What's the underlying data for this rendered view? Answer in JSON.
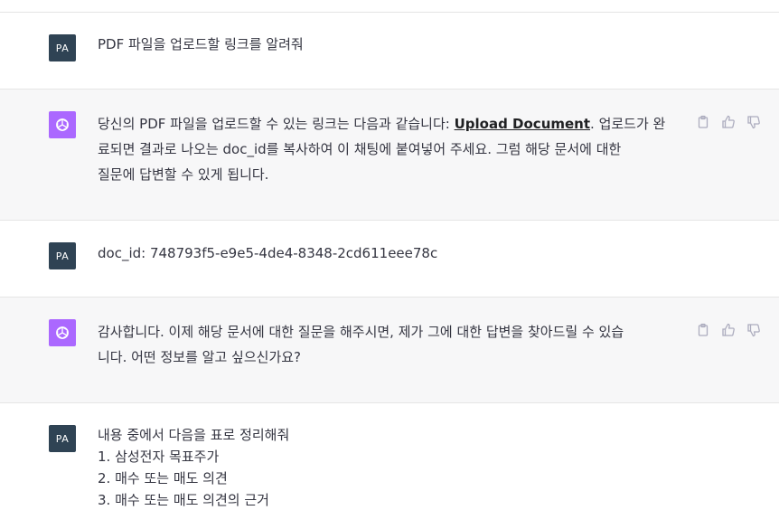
{
  "user_initials": "PA",
  "messages": [
    {
      "role": "user",
      "lines": [
        "PDF 파일을 업로드할 링크를 알려줘"
      ]
    },
    {
      "role": "assistant",
      "line1_pre": "당신의 PDF 파일을 업로드할 수 있는 링크는 다음과 같습니다: ",
      "link_text": "Upload Document",
      "line1_post": ". 업로드가 완",
      "line2": "료되면 결과로 나오는 doc_id를 복사하여 이 채팅에 붙여넣어 주세요. 그럼 해당 문서에 대한",
      "line3": "질문에 답변할 수 있게 됩니다."
    },
    {
      "role": "user",
      "lines": [
        "doc_id: 748793f5-e9e5-4de4-8348-2cd611eee78c"
      ]
    },
    {
      "role": "assistant",
      "line1": "감사합니다. 이제 해당 문서에 대한 질문을 해주시면, 제가 그에 대한 답변을 찾아드릴 수 있습",
      "line2": "니다. 어떤 정보를 알고 싶으신가요?"
    },
    {
      "role": "user",
      "lines": [
        "내용 중에서 다음을 표로 정리해줘",
        "1. 삼성전자 목표주가",
        "2. 매수 또는 매도 의견",
        "3. 매수 또는 매도 의견의 근거"
      ]
    }
  ],
  "icons": {
    "assistant_avatar": "openai-logo-icon",
    "copy": "clipboard-icon",
    "like": "thumbs-up-icon",
    "dislike": "thumbs-down-icon"
  },
  "colors": {
    "user_avatar_bg": "#2f4354",
    "assistant_avatar_bg": "#ab68ff",
    "assistant_row_bg": "#f7f7f8"
  }
}
